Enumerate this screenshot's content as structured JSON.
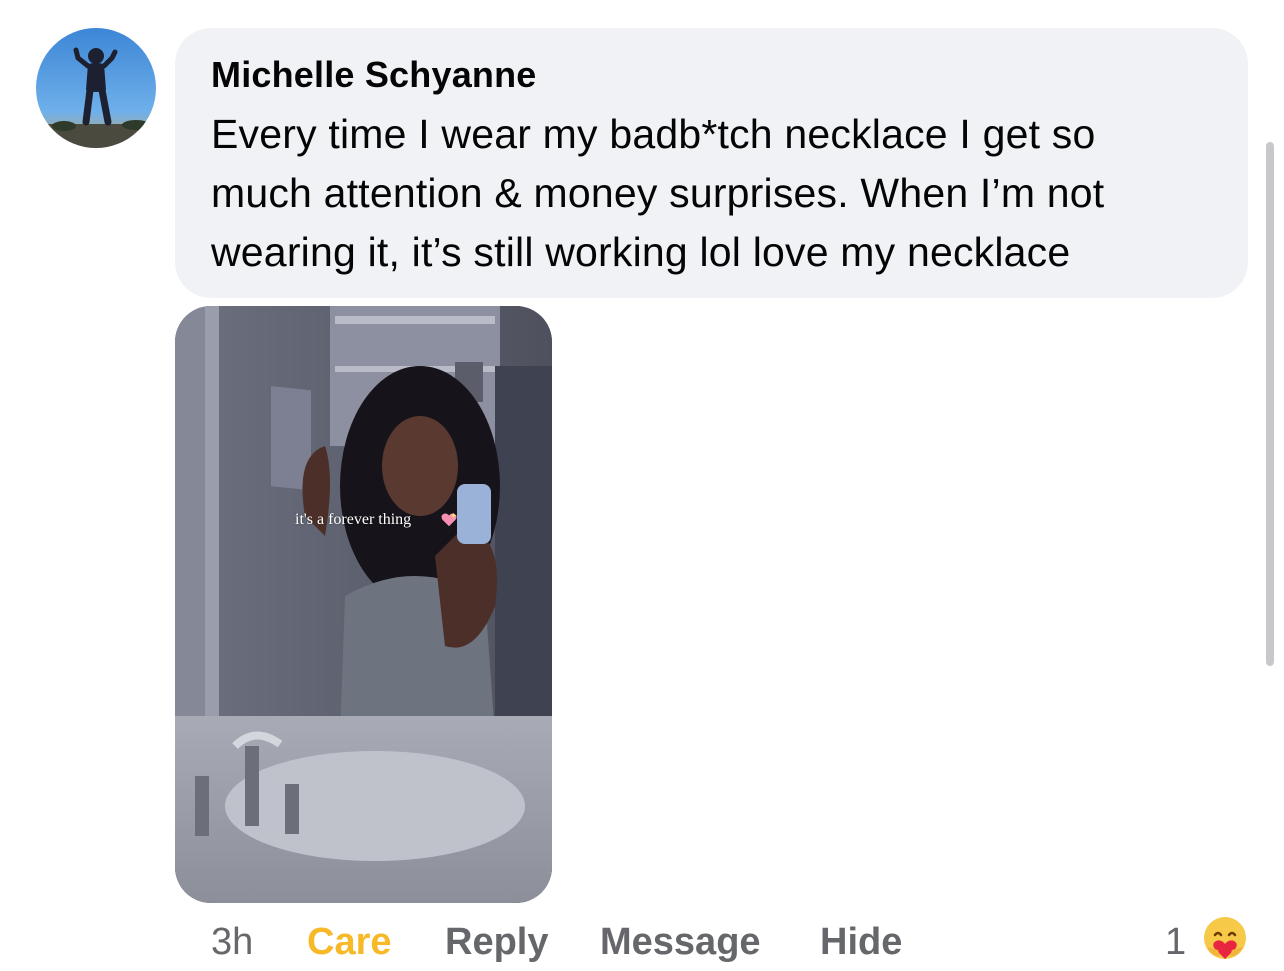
{
  "comment": {
    "author": "Michelle Schyanne",
    "text_lines": [
      "Every time I wear my badb*tch necklace I get so",
      "much attention & money surprises. When I’m not",
      "wearing it, it’s still working lol love my necklace"
    ],
    "photo_caption": "it's a forever thing"
  },
  "actions": {
    "time": "3h",
    "care": "Care",
    "reply": "Reply",
    "message": "Message",
    "hide": "Hide"
  },
  "reactions": {
    "count": "1",
    "icon": "care-reaction-icon"
  },
  "colors": {
    "bubble_bg": "#f0f2f5",
    "care": "#f7b928",
    "action_text": "#65676b",
    "text": "#050505"
  }
}
